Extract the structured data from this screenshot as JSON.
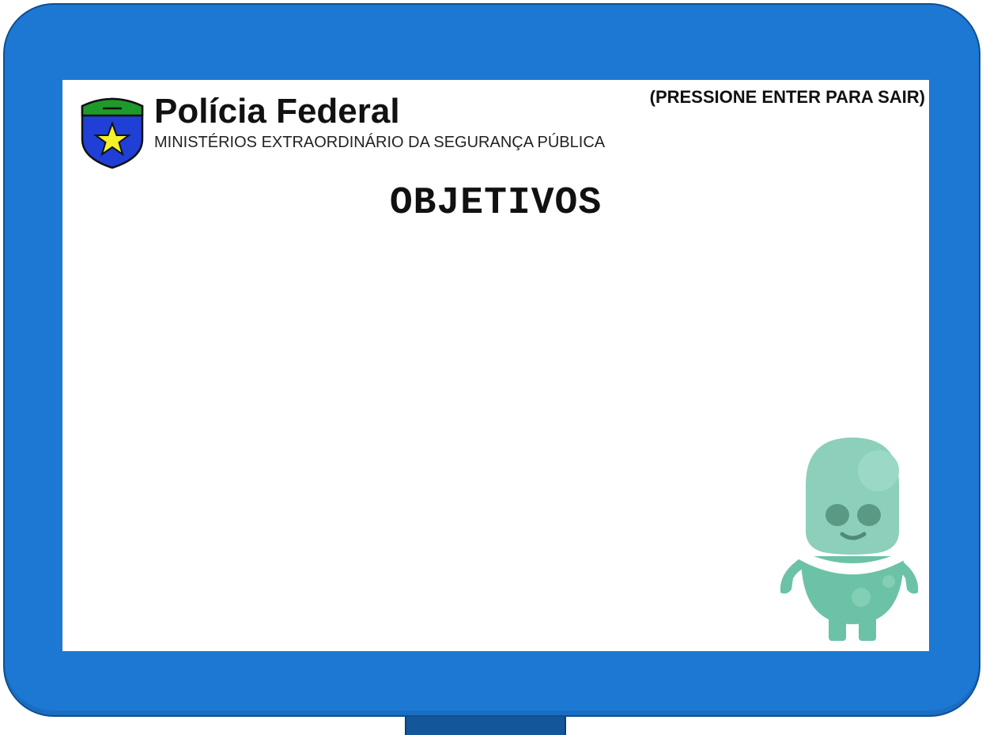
{
  "header": {
    "title": "Polícia Federal",
    "subtitle": "MINISTÉRIOS EXTRAORDINÁRIO DA SEGURANÇA PÚBLICA",
    "exit_hint": "(PRESSIONE ENTER PARA SAIR)"
  },
  "main": {
    "heading": "OBJETIVOS"
  },
  "icons": {
    "logo": "police-badge-icon",
    "mascot": "green-alien-mascot"
  },
  "colors": {
    "frame": "#1d78d3",
    "frame_border": "#0f4f8f",
    "stand": "#13579a",
    "screen": "#ffffff",
    "badge_blue": "#1f3fd6",
    "badge_green": "#1e9a2a",
    "badge_star": "#f4f02a",
    "mascot": "#7fcbb0"
  }
}
